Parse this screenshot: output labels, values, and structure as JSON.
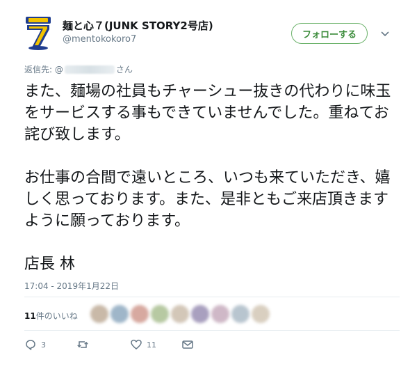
{
  "profile": {
    "name": "麺と心７(JUNK STORY2号店)",
    "handle": "@mentokokoro7"
  },
  "follow_label": "フォローする",
  "reply": {
    "prefix": "返信先: @",
    "suffix": "さん"
  },
  "tweet": {
    "paragraph1": "また、麺場の社員もチャーシュー抜きの代わりに味玉をサービスする事もできていませんでした。重ねてお詫び致します。",
    "paragraph2": "お仕事の合間で遠いところ、いつも来ていただき、嬉しく思っております。また、是非ともご来店頂きますように願っております。",
    "signature": "店長 林"
  },
  "timestamp": "17:04 - 2019年1月22日",
  "likes": {
    "count": "11",
    "label": "件のいいね"
  },
  "actions": {
    "reply_count": "3",
    "retweet_count": "",
    "like_count": "11"
  },
  "colors": {
    "follow_accent": "#3a8b39",
    "follow_border": "#6bb26a",
    "secondary_text": "#657786",
    "avatar_blue": "#1f3d8f",
    "avatar_yellow": "#f2c300"
  },
  "icons": {
    "reply": "reply-icon",
    "retweet": "retweet-icon",
    "like": "heart-icon",
    "message": "envelope-icon",
    "caret": "chevron-down-icon"
  }
}
